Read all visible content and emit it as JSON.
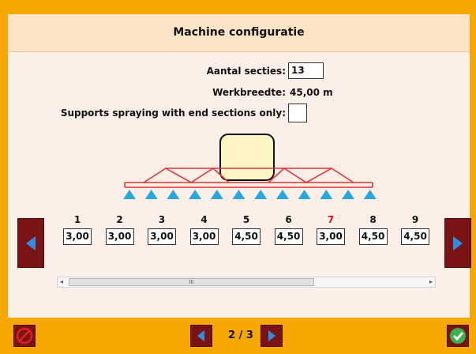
{
  "header": {
    "title": "Machine configuratie"
  },
  "form": {
    "aantal_label": "Aantal secties:",
    "aantal_value": "13",
    "werkbreedte_label": "Werkbreedte:",
    "werkbreedte_value": "45,00 m",
    "end_sections_label": "Supports spraying with end sections only:",
    "end_sections_checked": false
  },
  "sections": [
    {
      "number": "1",
      "width": "3,00",
      "highlight": false
    },
    {
      "number": "2",
      "width": "3,00",
      "highlight": false
    },
    {
      "number": "3",
      "width": "3,00",
      "highlight": false
    },
    {
      "number": "4",
      "width": "3,00",
      "highlight": false
    },
    {
      "number": "5",
      "width": "4,50",
      "highlight": false
    },
    {
      "number": "6",
      "width": "4,50",
      "highlight": false
    },
    {
      "number": "7",
      "width": "3,00",
      "highlight": true
    },
    {
      "number": "8",
      "width": "4,50",
      "highlight": false
    },
    {
      "number": "9",
      "width": "4,50",
      "highlight": false
    }
  ],
  "scrollbar": {
    "grip": "III"
  },
  "pager": {
    "text": "2 / 3"
  },
  "colors": {
    "accent": "#f7a800",
    "dark_red": "#7a1414",
    "nozzle": "#29a8e0",
    "boom": "#e8323a",
    "highlight_number": "#e01010"
  }
}
